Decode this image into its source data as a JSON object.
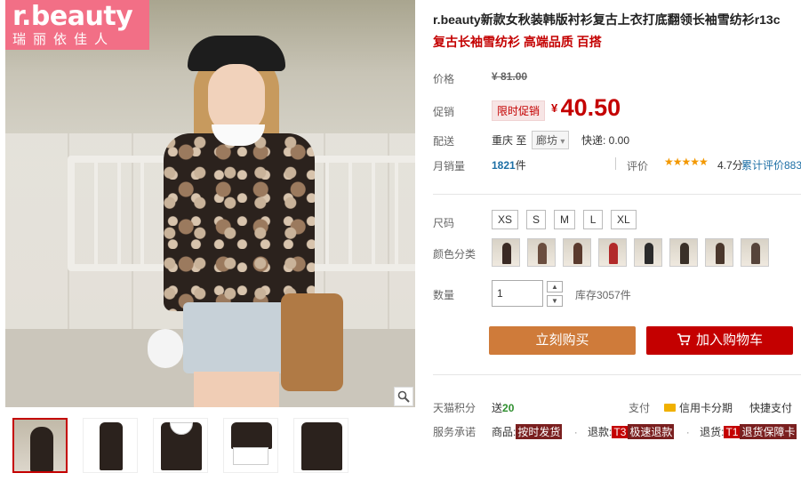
{
  "brand": {
    "logo_line1": "r.beauty",
    "logo_line2": "瑞丽依佳人"
  },
  "product": {
    "title": "r.beauty新款女秋装韩版衬衫复古上衣打底翻领长袖雪纺衫r13c",
    "subtitle": "复古长袖雪纺衫 高端品质 百搭"
  },
  "labels": {
    "price": "价格",
    "promo": "促销",
    "delivery": "配送",
    "monthly_sales": "月销量",
    "size": "尺码",
    "color": "颜色分类",
    "quantity": "数量",
    "points": "天猫积分",
    "payment": "支付",
    "service": "服务承诺"
  },
  "price": {
    "original": "¥ 81.00",
    "promo_tag": "限时促销",
    "currency": "¥",
    "current": "40.50"
  },
  "delivery": {
    "from": "重庆 至",
    "to": "廊坊",
    "to_chevron": "▾",
    "fee": "快递: 0.00"
  },
  "sales": {
    "count": "1821",
    "unit": "件",
    "rating_label": "评价",
    "stars": "★★★★★",
    "score": "4.7分",
    "total": "累计评价883"
  },
  "sizes": [
    "XS",
    "S",
    "M",
    "L",
    "XL"
  ],
  "colors": [
    "#3a2a24",
    "#6b4e3f",
    "#5a3a2d",
    "#b22a2a",
    "#2b2b2b",
    "#3a3028",
    "#4a372c",
    "#56443a"
  ],
  "quantity": {
    "value": "1",
    "up": "▲",
    "down": "▼",
    "stock": "库存3057件"
  },
  "buttons": {
    "buy_now": "立刻购买",
    "add_cart": "加入购物车"
  },
  "points": {
    "prefix": "送",
    "value": "20"
  },
  "payment": {
    "credit": "信用卡分期",
    "fast": "快捷支付"
  },
  "service": {
    "goods_label": "商品:",
    "goods_badge": "按时发货",
    "refund_label": "退款:",
    "refund_code": "T3",
    "refund_badge": "极速退款",
    "return_label": "退货:",
    "return_code": "T1",
    "return_badge": "退货保障卡",
    "sep": "·"
  }
}
